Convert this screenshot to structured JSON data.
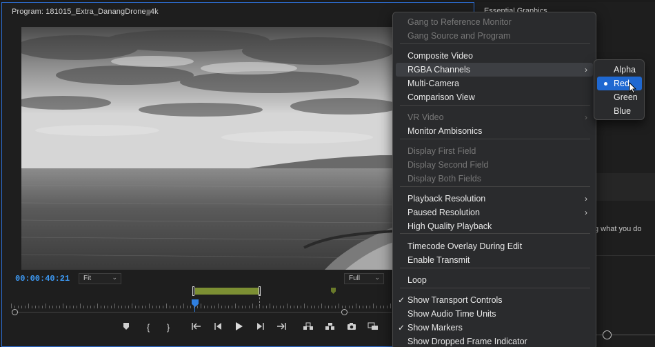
{
  "program_monitor": {
    "title": "Program: 181015_Extra_DanangDrone_4k",
    "menu_icon": "≡",
    "timecode": "00:00:40:21",
    "fit_select": "Fit",
    "resolution_select": "Full",
    "accent_color": "#2f7fe0"
  },
  "essential_graphics": {
    "title": "Essential Graphics",
    "menu_icon": "≡",
    "partial_text": "g what you do"
  },
  "context_menu": {
    "items": [
      {
        "label": "Gang to Reference Monitor",
        "disabled": true
      },
      {
        "label": "Gang Source and Program",
        "disabled": true
      },
      {
        "label": "Composite Video"
      },
      {
        "label": "RGBA Channels",
        "submenu": true,
        "highlighted": true
      },
      {
        "label": "Multi-Camera"
      },
      {
        "label": "Comparison View"
      },
      {
        "label": "VR Video",
        "disabled": true,
        "submenu": true
      },
      {
        "label": "Monitor Ambisonics"
      },
      {
        "label": "Display First Field",
        "disabled": true
      },
      {
        "label": "Display Second Field",
        "disabled": true
      },
      {
        "label": "Display Both Fields",
        "disabled": true
      },
      {
        "label": "Playback Resolution",
        "submenu": true
      },
      {
        "label": "Paused Resolution",
        "submenu": true
      },
      {
        "label": "High Quality Playback"
      },
      {
        "label": "Timecode Overlay During Edit"
      },
      {
        "label": "Enable Transmit"
      },
      {
        "label": "Loop"
      },
      {
        "label": "Show Transport Controls",
        "checked": true
      },
      {
        "label": "Show Audio Time Units"
      },
      {
        "label": "Show Markers",
        "checked": true
      },
      {
        "label": "Show Dropped Frame Indicator"
      }
    ],
    "submenu_arrow": "›",
    "check_mark": "✓"
  },
  "rgba_submenu": {
    "items": [
      "Alpha",
      "Red",
      "Green",
      "Blue"
    ],
    "selected": "Red",
    "selected_color": "#1f68d1"
  },
  "transport_icons": [
    "marker-icon",
    "mark-in-icon",
    "mark-out-icon",
    "go-to-in-icon",
    "step-back-icon",
    "play-icon",
    "step-forward-icon",
    "go-to-out-icon",
    "lift-icon",
    "extract-icon",
    "export-frame-icon",
    "comparison-icon"
  ]
}
